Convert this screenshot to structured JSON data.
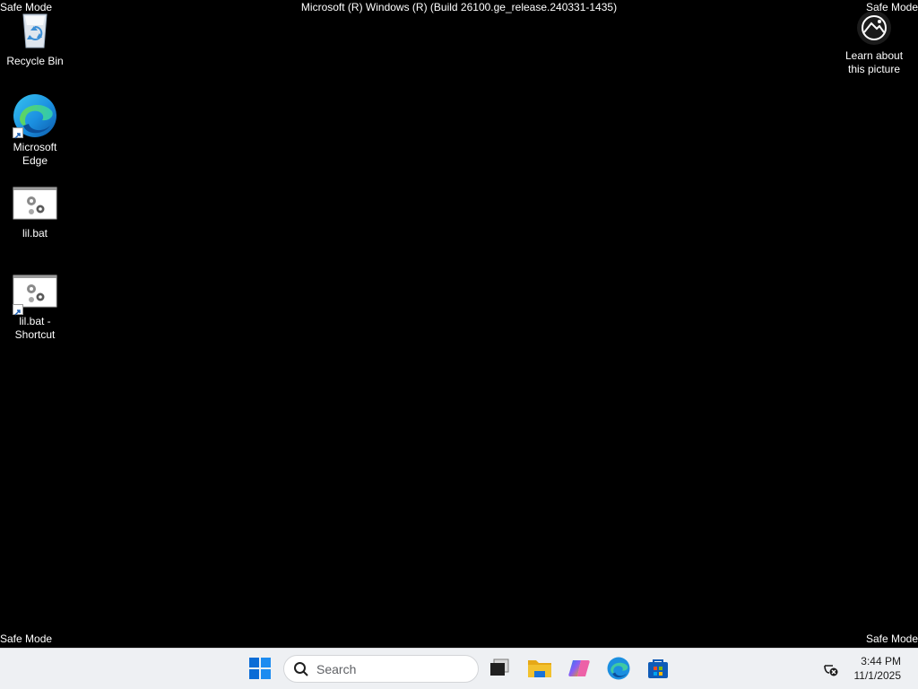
{
  "overlay": {
    "safe_mode_tl": "Safe Mode",
    "safe_mode_tr": "Safe Mode",
    "safe_mode_bl": "Safe Mode",
    "safe_mode_br": "Safe Mode",
    "build": "Microsoft (R) Windows (R) (Build 26100.ge_release.240331-1435)"
  },
  "desktop": {
    "icons": [
      {
        "label": "Recycle Bin",
        "icon": "recycle-bin-icon"
      },
      {
        "label": "Microsoft Edge",
        "icon": "edge-icon",
        "shortcut": true
      },
      {
        "label": "lil.bat",
        "icon": "batch-file-icon"
      },
      {
        "label": "lil.bat - Shortcut",
        "icon": "batch-file-icon",
        "shortcut": true
      }
    ],
    "learn": {
      "label": "Learn about this picture",
      "icon": "camera-icon"
    }
  },
  "taskbar": {
    "start_icon": "windows-start-icon",
    "search_placeholder": "Search",
    "pinned": [
      "task-view-icon",
      "file-explorer-icon",
      "copilot-icon",
      "edge-icon",
      "microsoft-store-icon"
    ],
    "time": "3:44 PM",
    "date": "11/1/2025",
    "tray_icon": "network-disconnected-icon"
  },
  "colors": {
    "desktop_bg": "#000000",
    "taskbar_bg": "#eef0f3",
    "start_blue": "#0a6cd6",
    "explorer_yellow": "#f2c12e",
    "store_blue": "#0f5bb8"
  }
}
